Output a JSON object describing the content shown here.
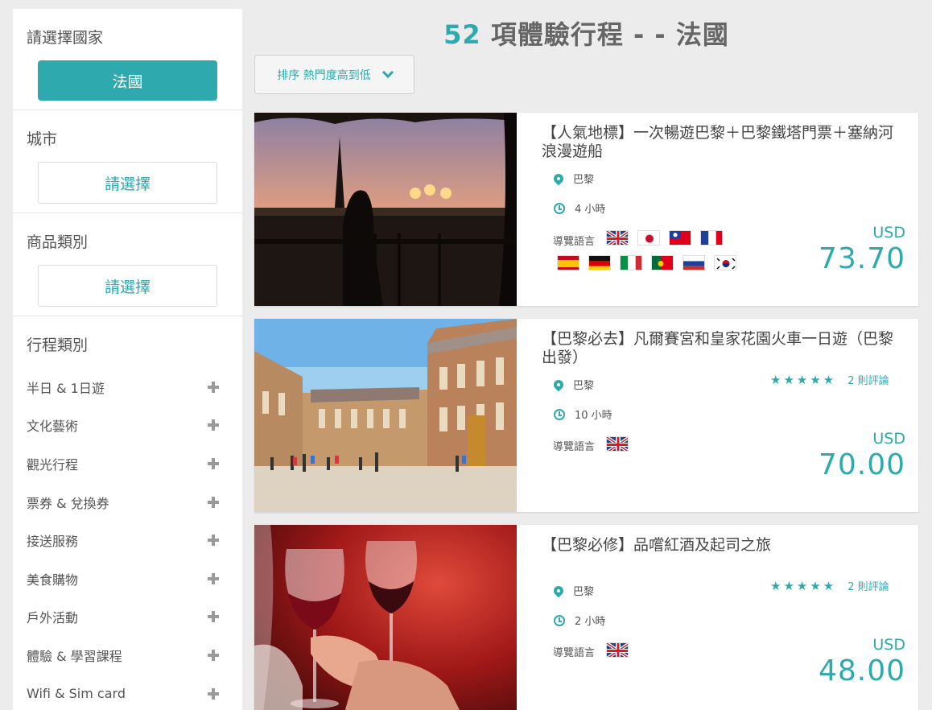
{
  "sidebar": {
    "country_title": "請選擇國家",
    "country_value": "法國",
    "city_title": "城市",
    "city_placeholder": "請選擇",
    "category_title": "商品類別",
    "category_placeholder": "請選擇",
    "trip_title": "行程類別",
    "trip_items": [
      "半日 & 1日遊",
      "文化藝術",
      "觀光行程",
      "票券 & 兌換券",
      "接送服務",
      "美食購物",
      "戶外活動",
      "體驗 & 學習課程",
      "Wifi & Sim card"
    ]
  },
  "header": {
    "count": "52",
    "title_text": "項體驗行程 - - 法國"
  },
  "sort": {
    "label": "排序 熱門度高到低"
  },
  "products": [
    {
      "title": "【人氣地標】一次暢遊巴黎＋巴黎鐵塔門票＋塞納河浪漫遊船",
      "city": "巴黎",
      "duration": "4 小時",
      "lang_label": "導覽語言",
      "languages": [
        "uk",
        "jp",
        "tw",
        "fr",
        "es",
        "de",
        "it",
        "pt",
        "ru",
        "kr"
      ],
      "currency": "USD",
      "price": "73.70"
    },
    {
      "title": "【巴黎必去】凡爾賽宮和皇家花園火車一日遊（巴黎出發）",
      "city": "巴黎",
      "duration": "10 小時",
      "lang_label": "導覽語言",
      "languages": [
        "uk"
      ],
      "stars": "★★★★★",
      "reviews": "2 則評論",
      "currency": "USD",
      "price": "70.00"
    },
    {
      "title": "【巴黎必修】品嚐紅酒及起司之旅",
      "city": "巴黎",
      "duration": "2 小時",
      "lang_label": "導覽語言",
      "languages": [
        "uk"
      ],
      "stars": "★★★★★",
      "reviews": "2 則評論",
      "currency": "USD",
      "price": "48.00"
    }
  ],
  "colors": {
    "accent": "#2eaaae",
    "background": "#ececec"
  }
}
